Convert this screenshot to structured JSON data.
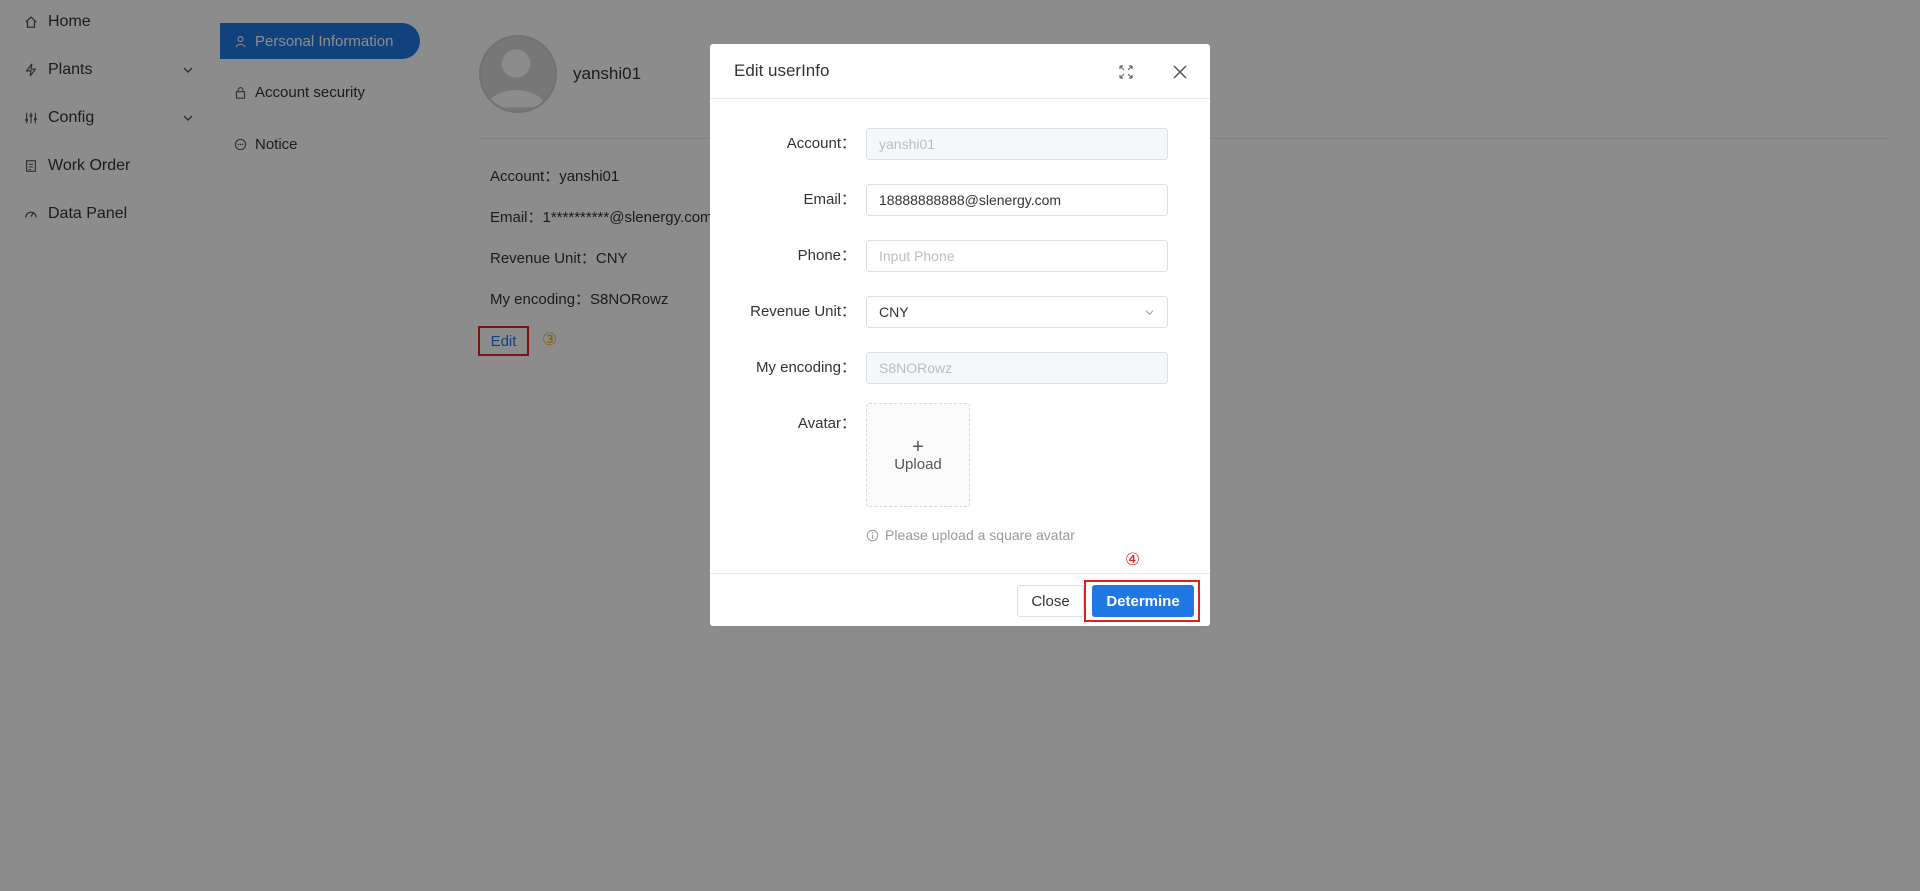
{
  "nav": {
    "items": [
      {
        "label": "Home",
        "icon": "home-icon"
      },
      {
        "label": "Plants",
        "icon": "bolt-icon",
        "expandable": true
      },
      {
        "label": "Config",
        "icon": "sliders-icon",
        "expandable": true
      },
      {
        "label": "Work Order",
        "icon": "clipboard-icon"
      },
      {
        "label": "Data Panel",
        "icon": "gauge-icon"
      }
    ]
  },
  "submenu": {
    "items": [
      {
        "label": "Personal Information",
        "icon": "user-icon",
        "active": true
      },
      {
        "label": "Account security",
        "icon": "lock-icon"
      },
      {
        "label": "Notice",
        "icon": "chat-icon"
      }
    ]
  },
  "profile": {
    "username": "yanshi01",
    "account_line": "Account：yanshi01",
    "email_line": "Email：1**********@slenergy.com",
    "revenue_line": "Revenue Unit：CNY",
    "encoding_line": "My encoding：S8NORowz",
    "edit_label": "Edit",
    "step_marker": "③"
  },
  "modal": {
    "title": "Edit userInfo",
    "fields": {
      "account": {
        "label": "Account：",
        "value": "yanshi01"
      },
      "email": {
        "label": "Email：",
        "value": "18888888888@slenergy.com"
      },
      "phone": {
        "label": "Phone：",
        "placeholder": "Input Phone"
      },
      "revenue_unit": {
        "label": "Revenue Unit：",
        "value": "CNY"
      },
      "encoding": {
        "label": "My encoding：",
        "value": "S8NORowz"
      },
      "avatar": {
        "label": "Avatar：",
        "upload_label": "Upload",
        "plus": "+"
      }
    },
    "hint": "Please upload a square avatar",
    "close_label": "Close",
    "confirm_label": "Determine",
    "step_marker": "④"
  },
  "colors": {
    "accent": "#1f78e6",
    "highlight": "#e02020",
    "step3": "#f0b400"
  }
}
